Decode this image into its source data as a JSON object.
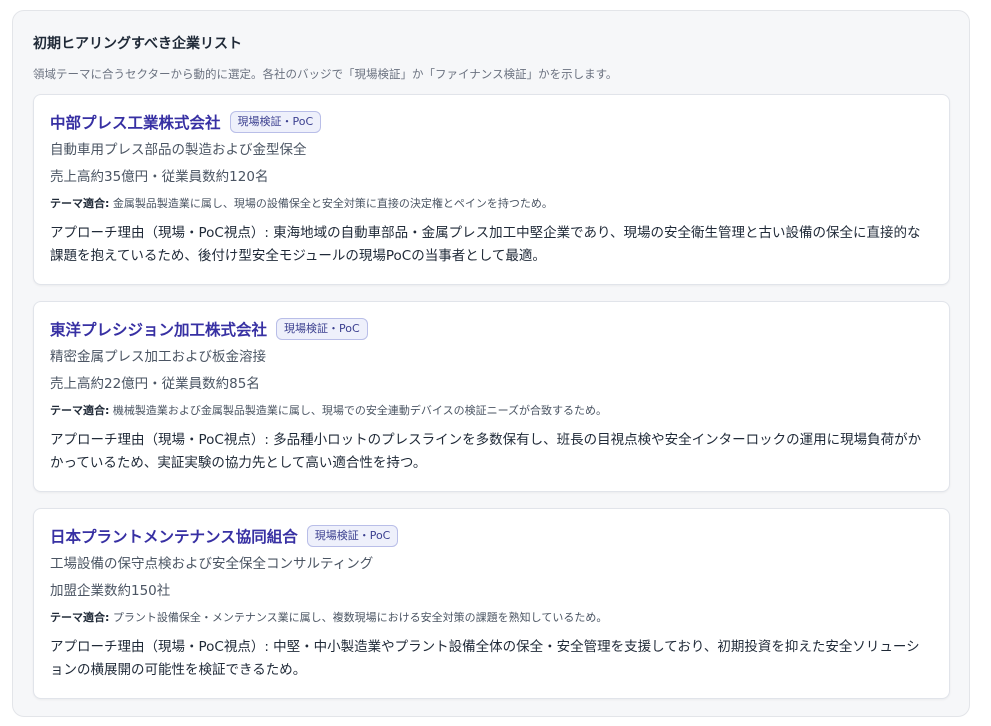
{
  "panel": {
    "title": "初期ヒアリングすべき企業リスト",
    "description": "領域テーマに合うセクターから動的に選定。各社のバッジで「現場検証」か「ファイナンス検証」かを示します。"
  },
  "fit_label": "テーマ適合:",
  "companies": [
    {
      "name": "中部プレス工業株式会社",
      "badge": "現場検証・PoC",
      "business": "自動車用プレス部品の製造および金型保全",
      "scale": "売上高約35億円・従業員数約120名",
      "fit": "金属製品製造業に属し、現場の設備保全と安全対策に直接の決定権とペインを持つため。",
      "reason": "アプローチ理由（現場・PoC視点）: 東海地域の自動車部品・金属プレス加工中堅企業であり、現場の安全衛生管理と古い設備の保全に直接的な課題を抱えているため、後付け型安全モジュールの現場PoCの当事者として最適。"
    },
    {
      "name": "東洋プレシジョン加工株式会社",
      "badge": "現場検証・PoC",
      "business": "精密金属プレス加工および板金溶接",
      "scale": "売上高約22億円・従業員数約85名",
      "fit": "機械製造業および金属製品製造業に属し、現場での安全連動デバイスの検証ニーズが合致するため。",
      "reason": "アプローチ理由（現場・PoC視点）: 多品種小ロットのプレスラインを多数保有し、班長の目視点検や安全インターロックの運用に現場負荷がかかっているため、実証実験の協力先として高い適合性を持つ。"
    },
    {
      "name": "日本プラントメンテナンス協同組合",
      "badge": "現場検証・PoC",
      "business": "工場設備の保守点検および安全保全コンサルティング",
      "scale": "加盟企業数約150社",
      "fit": "プラント設備保全・メンテナンス業に属し、複数現場における安全対策の課題を熟知しているため。",
      "reason": "アプローチ理由（現場・PoC視点）: 中堅・中小製造業やプラント設備全体の保全・安全管理を支援しており、初期投資を抑えた安全ソリューションの横展開の可能性を検証できるため。"
    }
  ]
}
